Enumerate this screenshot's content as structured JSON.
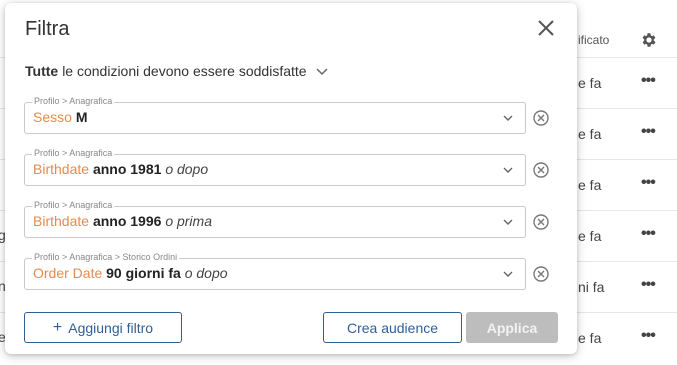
{
  "background": {
    "header_label": "ificato",
    "rows": [
      {
        "text": "e fa",
        "left": ""
      },
      {
        "text": "e fa",
        "left": ""
      },
      {
        "text": "e fa",
        "left": ""
      },
      {
        "text": "e fa",
        "left": "g"
      },
      {
        "text": "ni fa",
        "left": "n"
      },
      {
        "text": "e fa",
        "left": "e"
      }
    ]
  },
  "modal": {
    "title": "Filtra",
    "condition": {
      "bold": "Tutte",
      "rest": "le condizioni devono essere soddisfatte"
    },
    "filters": [
      {
        "path": "Profilo > Anagrafica",
        "field": "Sesso",
        "value": "M",
        "modifier": ""
      },
      {
        "path": "Profilo > Anagrafica",
        "field": "Birthdate",
        "value": "anno 1981",
        "modifier": "o dopo"
      },
      {
        "path": "Profilo > Anagrafica",
        "field": "Birthdate",
        "value": "anno 1996",
        "modifier": "o prima"
      },
      {
        "path": "Profilo > Anagrafica > Storico Ordini",
        "field": "Order Date",
        "value": "90 giorni fa",
        "modifier": "o dopo"
      }
    ],
    "add_filter_label": "Aggiungi filtro",
    "create_audience_label": "Crea audience",
    "apply_label": "Applica"
  },
  "colors": {
    "accent": "#2f5f95",
    "field": "#e58a4e",
    "disabled": "#bdbdbd"
  }
}
